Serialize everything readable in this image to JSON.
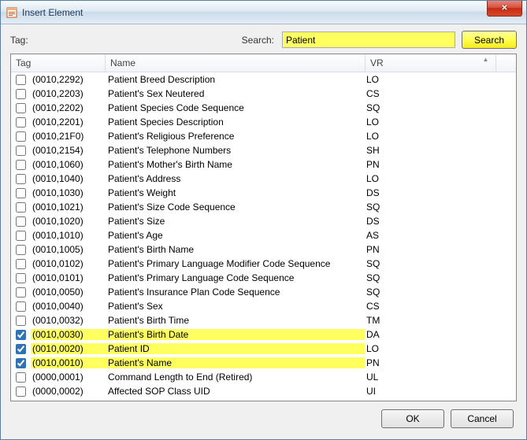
{
  "window": {
    "title": "Insert Element",
    "close_label": "✕"
  },
  "top": {
    "tag_label": "Tag:",
    "search_label": "Search:",
    "search_value": "Patient",
    "search_button": "Search"
  },
  "columns": {
    "tag": "Tag",
    "name": "Name",
    "vr": "VR"
  },
  "rows": [
    {
      "checked": false,
      "hl": false,
      "tag": "(0010,2292)",
      "name": "Patient Breed Description",
      "vr": "LO"
    },
    {
      "checked": false,
      "hl": false,
      "tag": "(0010,2203)",
      "name": "Patient's Sex Neutered",
      "vr": "CS"
    },
    {
      "checked": false,
      "hl": false,
      "tag": "(0010,2202)",
      "name": "Patient Species Code Sequence",
      "vr": "SQ"
    },
    {
      "checked": false,
      "hl": false,
      "tag": "(0010,2201)",
      "name": "Patient Species Description",
      "vr": "LO"
    },
    {
      "checked": false,
      "hl": false,
      "tag": "(0010,21F0)",
      "name": "Patient's Religious Preference",
      "vr": "LO"
    },
    {
      "checked": false,
      "hl": false,
      "tag": "(0010,2154)",
      "name": "Patient's Telephone Numbers",
      "vr": "SH"
    },
    {
      "checked": false,
      "hl": false,
      "tag": "(0010,1060)",
      "name": "Patient's Mother's Birth Name",
      "vr": "PN"
    },
    {
      "checked": false,
      "hl": false,
      "tag": "(0010,1040)",
      "name": "Patient's Address",
      "vr": "LO"
    },
    {
      "checked": false,
      "hl": false,
      "tag": "(0010,1030)",
      "name": "Patient's Weight",
      "vr": "DS"
    },
    {
      "checked": false,
      "hl": false,
      "tag": "(0010,1021)",
      "name": "Patient's Size Code Sequence",
      "vr": "SQ"
    },
    {
      "checked": false,
      "hl": false,
      "tag": "(0010,1020)",
      "name": "Patient's Size",
      "vr": "DS"
    },
    {
      "checked": false,
      "hl": false,
      "tag": "(0010,1010)",
      "name": "Patient's Age",
      "vr": "AS"
    },
    {
      "checked": false,
      "hl": false,
      "tag": "(0010,1005)",
      "name": "Patient's Birth Name",
      "vr": "PN"
    },
    {
      "checked": false,
      "hl": false,
      "tag": "(0010,0102)",
      "name": "Patient's Primary Language Modifier Code Sequence",
      "vr": "SQ"
    },
    {
      "checked": false,
      "hl": false,
      "tag": "(0010,0101)",
      "name": "Patient's Primary Language Code Sequence",
      "vr": "SQ"
    },
    {
      "checked": false,
      "hl": false,
      "tag": "(0010,0050)",
      "name": "Patient's Insurance Plan Code Sequence",
      "vr": "SQ"
    },
    {
      "checked": false,
      "hl": false,
      "tag": "(0010,0040)",
      "name": "Patient's Sex",
      "vr": "CS"
    },
    {
      "checked": false,
      "hl": false,
      "tag": "(0010,0032)",
      "name": "Patient's Birth Time",
      "vr": "TM"
    },
    {
      "checked": true,
      "hl": true,
      "tag": "(0010,0030)",
      "name": "Patient's Birth Date",
      "vr": "DA"
    },
    {
      "checked": true,
      "hl": true,
      "tag": "(0010,0020)",
      "name": "Patient ID",
      "vr": "LO"
    },
    {
      "checked": true,
      "hl": true,
      "tag": "(0010,0010)",
      "name": "Patient's Name",
      "vr": "PN"
    },
    {
      "checked": false,
      "hl": false,
      "tag": "(0000,0001)",
      "name": "Command Length to End (Retired)",
      "vr": "UL"
    },
    {
      "checked": false,
      "hl": false,
      "tag": "(0000,0002)",
      "name": "Affected SOP Class UID",
      "vr": "UI"
    }
  ],
  "buttons": {
    "ok": "OK",
    "cancel": "Cancel"
  }
}
